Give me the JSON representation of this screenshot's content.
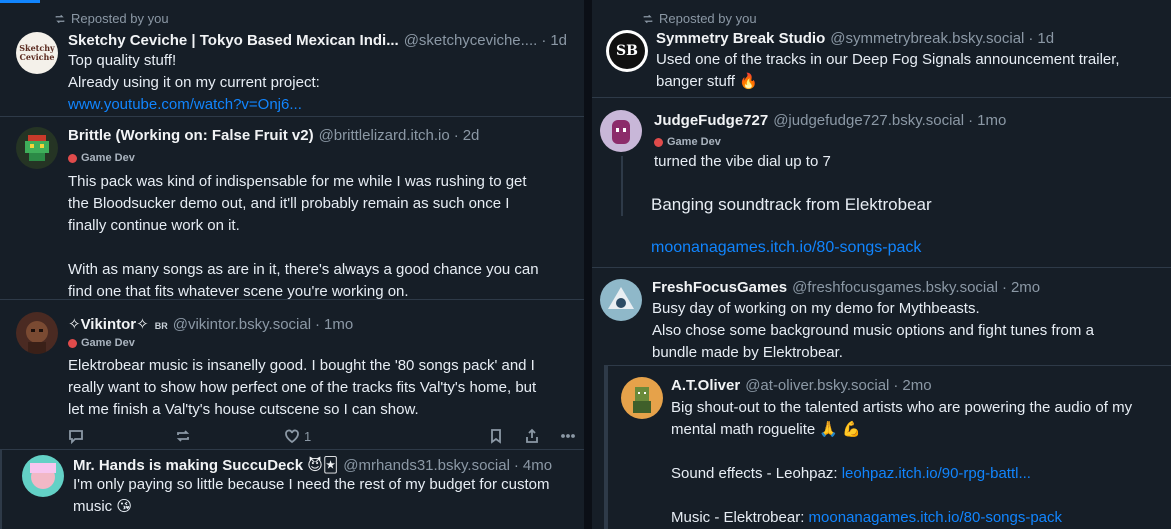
{
  "left": {
    "post1": {
      "repost_label": "Reposted by you",
      "name": "Sketchy Ceviche | Tokyo Based Mexican Indi...",
      "handle": "@sketchyceviche....",
      "dot": "·",
      "time": "1d",
      "avatar_text": "Sketchy Ceviche",
      "lines": [
        "Top quality stuff!",
        "Already using it on my current project:"
      ],
      "link": "www.youtube.com/watch?v=Onj6..."
    },
    "post2": {
      "name": "Brittle (Working on: False Fruit v2)",
      "handle": "@brittlelizard.itch.io",
      "dot": "·",
      "time": "2d",
      "tag": "Game Dev",
      "lines": [
        "This pack was kind of indispensable for me while I was rushing to get",
        "the Bloodsucker demo out, and it'll probably remain as such once I",
        "finally continue work on it.",
        "",
        "With as many songs as are in it, there's always a good chance you can",
        "find one that fits whatever scene you're working on."
      ]
    },
    "post3": {
      "name": "✧Vikintor✧",
      "name_badge": "BR",
      "handle": "@vikintor.bsky.social",
      "dot": "·",
      "time": "1mo",
      "tag": "Game Dev",
      "lines": [
        "Elektrobear music is insanelly good. I bought the '80 songs pack' and I",
        "really want to show how perfect one of the tracks fits Val'ty's home, but",
        "let me finish a Val'ty's house cutscene so I can show."
      ],
      "like_count": "1"
    },
    "post4": {
      "name": "Mr. Hands is making SuccuDeck 😈🃏",
      "handle": "@mrhands31.bsky.social",
      "dot": "·",
      "time": "4mo",
      "lines": [
        "I'm only paying so little because I need the rest of my budget for custom",
        "music 😘"
      ]
    }
  },
  "right": {
    "post1": {
      "repost_label": "Reposted by you",
      "name": "Symmetry Break Studio",
      "handle": "@symmetrybreak.bsky.social",
      "dot": "·",
      "time": "1d",
      "avatar_text": "SB",
      "lines": [
        "Used one of the tracks in our Deep Fog Signals announcement trailer,",
        "banger stuff 🔥"
      ]
    },
    "post2": {
      "name": "JudgeFudge727",
      "handle": "@judgefudge727.bsky.social",
      "dot": "·",
      "time": "1mo",
      "tag": "Game Dev",
      "line1": "turned the vibe dial up to 7",
      "quote_text": "Banging soundtrack from Elektrobear",
      "quote_link": "moonanagames.itch.io/80-songs-pack"
    },
    "post3": {
      "name": "FreshFocusGames",
      "handle": "@freshfocusgames.bsky.social",
      "dot": "·",
      "time": "2mo",
      "lines": [
        "Busy day of working on my demo for Mythbeasts.",
        "Also chose some background music options and fight tunes from a",
        "bundle made by Elektrobear."
      ],
      "quote": {
        "name": "A.T.Oliver",
        "handle": "@at-oliver.bsky.social",
        "dot": "·",
        "time": "2mo",
        "lines": [
          "Big shout-out to the talented artists who are powering the audio of my",
          "mental math roguelite 🙏 💪"
        ],
        "sfx_label": "Sound effects - Leohpaz: ",
        "sfx_link": "leohpaz.itch.io/90-rpg-battl...",
        "music_label": "Music - Elektrobear: ",
        "music_link": "moonanagames.itch.io/80-songs-pack"
      }
    }
  },
  "colors": {
    "accent": "#1185fe",
    "background": "#161e27",
    "border": "#2e3a48",
    "muted": "#8b98a5"
  },
  "icons": [
    "repost-icon",
    "reply-icon",
    "like-icon",
    "bookmark-icon",
    "share-icon",
    "more-icon"
  ]
}
